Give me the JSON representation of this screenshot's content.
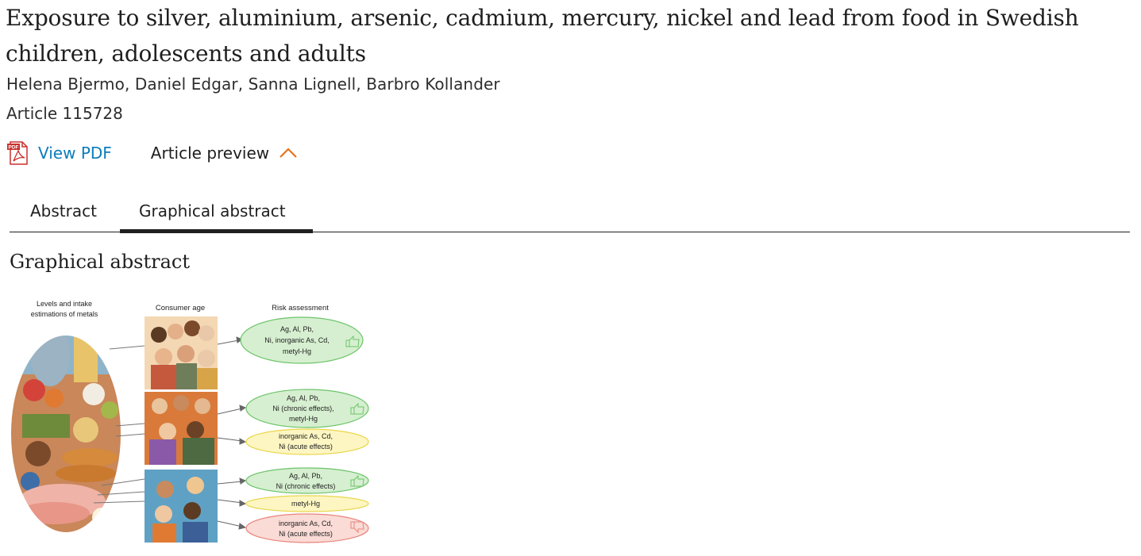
{
  "article": {
    "title": "Exposure to silver, aluminium, arsenic, cadmium, mercury, nickel and lead from food in Swedish children, adolescents and adults",
    "authors": "Helena Bjermo, Daniel Edgar, Sanna Lignell, Barbro Kollander",
    "article_number": "Article 115728"
  },
  "actions": {
    "view_pdf": "View PDF",
    "article_preview": "Article preview",
    "pdf_icon_text": "PDF"
  },
  "tabs": [
    {
      "label": "Abstract",
      "active": false
    },
    {
      "label": "Graphical abstract",
      "active": true
    }
  ],
  "section": {
    "heading": "Graphical abstract"
  },
  "graphical_abstract": {
    "col_levels_line1": "Levels and intake",
    "col_levels_line2": "estimations of metals",
    "col_age": "Consumer age",
    "col_risk": "Risk assessment",
    "adults_safe_l1": "Ag, Al, Pb,",
    "adults_safe_l2": "Ni, inorganic As, Cd,",
    "adults_safe_l3": "metyl-Hg",
    "teens_safe_l1": "Ag, Al, Pb,",
    "teens_safe_l2": "Ni (chronic effects),",
    "teens_safe_l3": "metyl-Hg",
    "teens_warn_l1": "inorganic As, Cd,",
    "teens_warn_l2": "Ni (acute effects)",
    "kids_safe_l1": "Ag, Al, Pb,",
    "kids_safe_l2": "Ni (chronic effects)",
    "kids_warn_l1": "metyl-Hg",
    "kids_risk_l1": "inorganic As, Cd,",
    "kids_risk_l2": "Ni (acute effects)"
  },
  "colors": {
    "link": "#0c7dbb",
    "accent_chevron": "#e9711c",
    "safe_fill": "#d6efd0",
    "safe_stroke": "#6cc46a",
    "warn_fill": "#fdf6c2",
    "warn_stroke": "#e8d64a",
    "risk_fill": "#fadbd6",
    "risk_stroke": "#e9837a"
  }
}
